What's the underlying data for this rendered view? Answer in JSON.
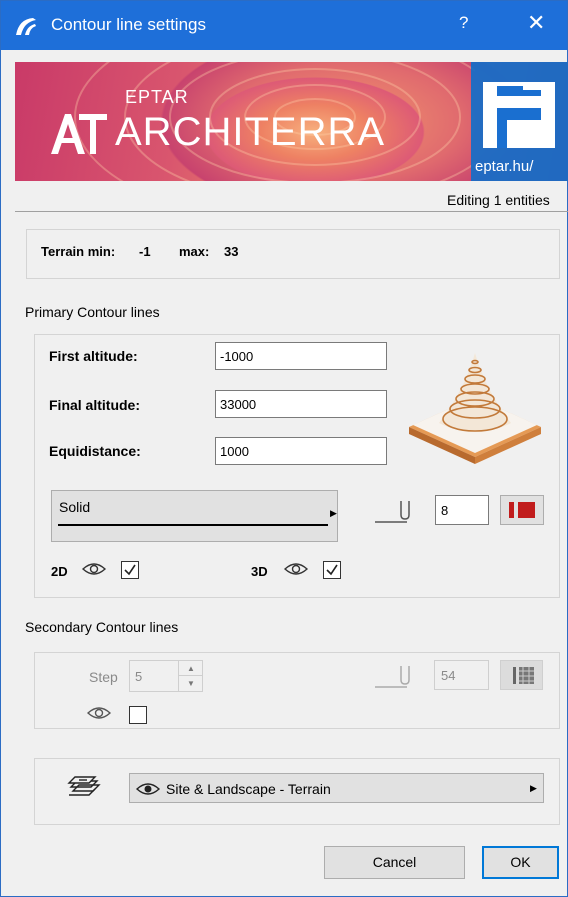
{
  "window": {
    "title": "Contour line settings",
    "help_label": "?",
    "close_label": "✕",
    "accent": "#1e6fd9"
  },
  "banner": {
    "brand_small": "EPTAR",
    "brand_large": "ARCHITERRA",
    "domain": "eptar.hu/"
  },
  "editing_status": "Editing 1 entities",
  "terrain": {
    "label": "Terrain min:",
    "min": "-1",
    "max_label": "max:",
    "max": "33"
  },
  "primary": {
    "section_title": "Primary Contour lines",
    "first_altitude_label": "First altitude:",
    "first_altitude": "-1000",
    "final_altitude_label": "Final altitude:",
    "final_altitude": "33000",
    "equidistance_label": "Equidistance:",
    "equidistance": "1000",
    "line_type": "Solid",
    "pen_number": "8",
    "pen_color": "#c11c1c",
    "label_2d": "2D",
    "checked_2d": true,
    "label_3d": "3D",
    "checked_3d": true
  },
  "secondary": {
    "section_title": "Secondary Contour lines",
    "step_label": "Step",
    "step_value": "5",
    "pen_number": "54",
    "visible_checked": false
  },
  "layer": {
    "name": "Site & Landscape - Terrain"
  },
  "buttons": {
    "cancel": "Cancel",
    "ok": "OK"
  }
}
